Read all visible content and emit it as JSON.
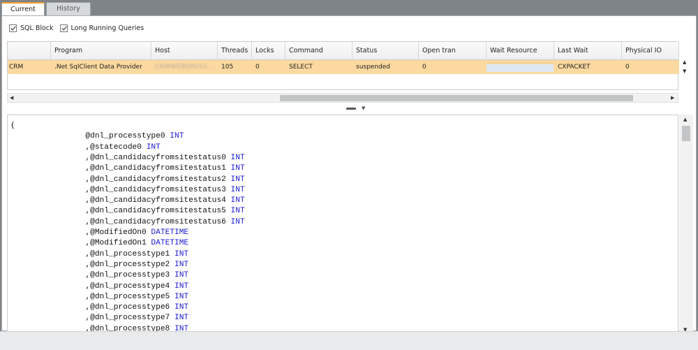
{
  "tabs": [
    {
      "label": "Current",
      "active": true
    },
    {
      "label": "History",
      "active": false
    }
  ],
  "filters": [
    {
      "label": "SQL Block",
      "checked": true
    },
    {
      "label": "Long Running Queries",
      "checked": true
    }
  ],
  "grid": {
    "columns": [
      "",
      "Program",
      "Host",
      "Threads",
      "Locks",
      "Command",
      "Status",
      "Open tran",
      "Wait Resource",
      "Last Wait",
      "Physical IO"
    ],
    "rows": [
      [
        "CRM",
        ".Net SqlClient Data Provider",
        "CRMWEBSRV01...",
        "105",
        "0",
        "SELECT",
        "suspended",
        "0",
        "",
        "CXPACKET",
        "0"
      ]
    ]
  },
  "editor": {
    "lines": [
      [
        {
          "t": "(",
          "k": false
        }
      ],
      [
        {
          "t": "                @dnl_processtype0 ",
          "k": false
        },
        {
          "t": "INT",
          "k": true
        }
      ],
      [
        {
          "t": "                ,@statecode0 ",
          "k": false
        },
        {
          "t": "INT",
          "k": true
        }
      ],
      [
        {
          "t": "                ,@dnl_candidacyfromsitestatus0 ",
          "k": false
        },
        {
          "t": "INT",
          "k": true
        }
      ],
      [
        {
          "t": "                ,@dnl_candidacyfromsitestatus1 ",
          "k": false
        },
        {
          "t": "INT",
          "k": true
        }
      ],
      [
        {
          "t": "                ,@dnl_candidacyfromsitestatus2 ",
          "k": false
        },
        {
          "t": "INT",
          "k": true
        }
      ],
      [
        {
          "t": "                ,@dnl_candidacyfromsitestatus3 ",
          "k": false
        },
        {
          "t": "INT",
          "k": true
        }
      ],
      [
        {
          "t": "                ,@dnl_candidacyfromsitestatus4 ",
          "k": false
        },
        {
          "t": "INT",
          "k": true
        }
      ],
      [
        {
          "t": "                ,@dnl_candidacyfromsitestatus5 ",
          "k": false
        },
        {
          "t": "INT",
          "k": true
        }
      ],
      [
        {
          "t": "                ,@dnl_candidacyfromsitestatus6 ",
          "k": false
        },
        {
          "t": "INT",
          "k": true
        }
      ],
      [
        {
          "t": "                ,@ModifiedOn0 ",
          "k": false
        },
        {
          "t": "DATETIME",
          "k": true
        }
      ],
      [
        {
          "t": "                ,@ModifiedOn1 ",
          "k": false
        },
        {
          "t": "DATETIME",
          "k": true
        }
      ],
      [
        {
          "t": "                ,@dnl_processtype1 ",
          "k": false
        },
        {
          "t": "INT",
          "k": true
        }
      ],
      [
        {
          "t": "                ,@dnl_processtype2 ",
          "k": false
        },
        {
          "t": "INT",
          "k": true
        }
      ],
      [
        {
          "t": "                ,@dnl_processtype3 ",
          "k": false
        },
        {
          "t": "INT",
          "k": true
        }
      ],
      [
        {
          "t": "                ,@dnl_processtype4 ",
          "k": false
        },
        {
          "t": "INT",
          "k": true
        }
      ],
      [
        {
          "t": "                ,@dnl_processtype5 ",
          "k": false
        },
        {
          "t": "INT",
          "k": true
        }
      ],
      [
        {
          "t": "                ,@dnl_processtype6 ",
          "k": false
        },
        {
          "t": "INT",
          "k": true
        }
      ],
      [
        {
          "t": "                ,@dnl_processtype7 ",
          "k": false
        },
        {
          "t": "INT",
          "k": true
        }
      ],
      [
        {
          "t": "                ,@dnl_processtype8 ",
          "k": false
        },
        {
          "t": "INT",
          "k": true
        }
      ]
    ]
  },
  "colors": {
    "active_tab_accent": "#f39c2c",
    "selected_row": "#fcd9a0",
    "keyword": "#1a1ad0"
  }
}
